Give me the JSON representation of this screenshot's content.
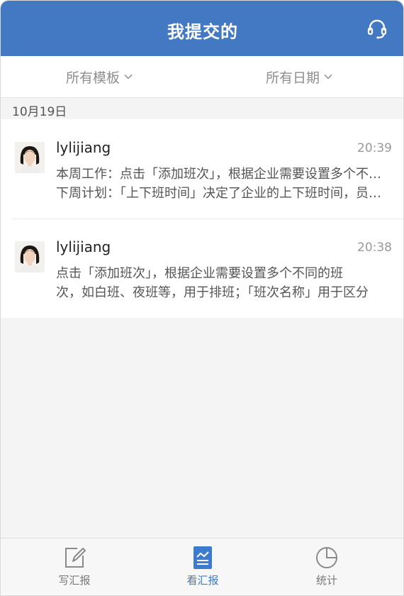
{
  "header": {
    "title": "我提交的",
    "support_icon": "headset-icon"
  },
  "filters": {
    "template": "所有模板",
    "date": "所有日期"
  },
  "date_group": "10月19日",
  "reports": [
    {
      "author": "lylijiang",
      "time": "20:39",
      "line1": "本周工作：点击「添加班次」，根据企业需要设置多个不同的班次",
      "line2": "下周计划：「上下班时间」决定了企业的上下班时间，员工打卡"
    },
    {
      "author": "lylijiang",
      "time": "20:38",
      "line1": "点击「添加班次」，根据企业需要设置多个不同的班",
      "line2": "次，如白班、夜班等，用于排班；「班次名称」用于区分"
    }
  ],
  "tabbar": {
    "tabs": [
      {
        "label": "写汇报",
        "icon": "edit-icon"
      },
      {
        "label": "看汇报",
        "icon": "report-icon"
      },
      {
        "label": "统计",
        "icon": "pie-chart-icon"
      }
    ],
    "active_index": 1
  },
  "colors": {
    "header": "#4378c2",
    "active_tab": "#3d7bd0"
  }
}
